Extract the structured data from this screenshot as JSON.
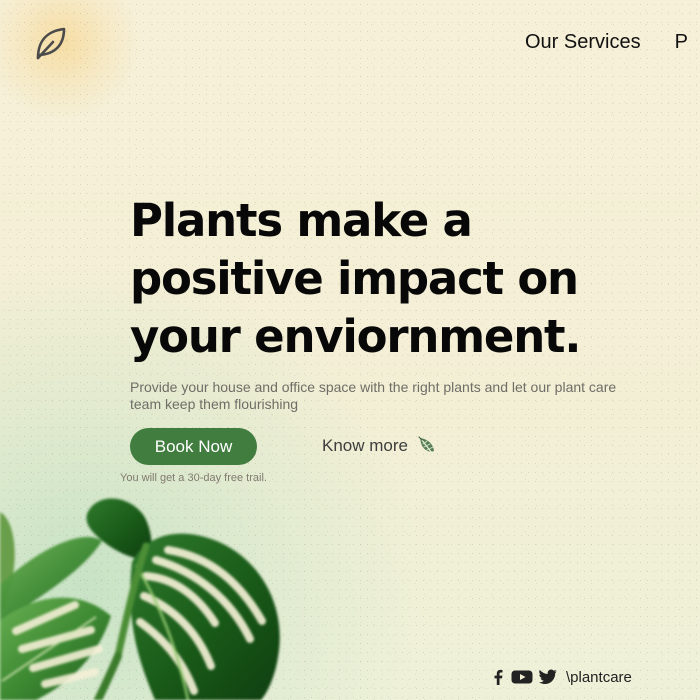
{
  "nav": {
    "items": [
      {
        "label": "Our Services"
      },
      {
        "label": "P"
      }
    ]
  },
  "hero": {
    "title": "Plants make a positive impact on your enviornment.",
    "description": "Provide your house and office space with the right plants and let our plant care team keep them flourishing",
    "primary_button": "Book Now",
    "secondary_link": "Know more",
    "trial_note": "You will get a 30-day free trail."
  },
  "footer": {
    "handle": "\\plantcare",
    "social_icons": [
      "facebook-icon",
      "youtube-icon",
      "twitter-icon"
    ]
  },
  "colors": {
    "background": "#f5efd6",
    "accent_green": "#417d3f",
    "text_primary": "#080808",
    "text_muted": "#6f6d66",
    "logo_glow": "#f6cd78"
  }
}
